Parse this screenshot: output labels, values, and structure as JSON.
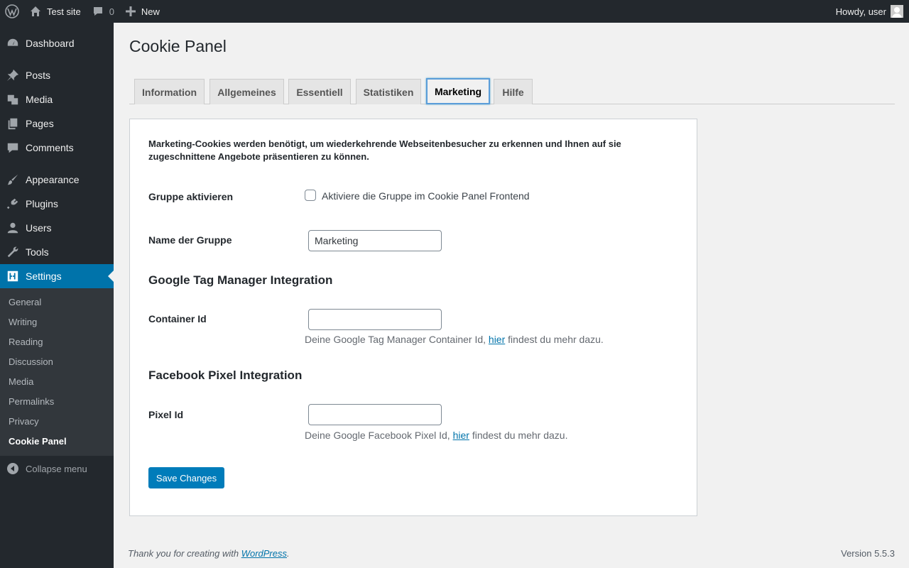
{
  "adminbar": {
    "site_name": "Test site",
    "comments_count": "0",
    "new_label": "New",
    "howdy": "Howdy, user"
  },
  "sidebar": {
    "items": [
      {
        "label": "Dashboard",
        "icon": "dashboard-icon"
      },
      {
        "label": "Posts",
        "icon": "pin-icon"
      },
      {
        "label": "Media",
        "icon": "media-icon"
      },
      {
        "label": "Pages",
        "icon": "pages-icon"
      },
      {
        "label": "Comments",
        "icon": "comment-icon"
      },
      {
        "label": "Appearance",
        "icon": "brush-icon"
      },
      {
        "label": "Plugins",
        "icon": "plug-icon"
      },
      {
        "label": "Users",
        "icon": "user-icon"
      },
      {
        "label": "Tools",
        "icon": "wrench-icon"
      },
      {
        "label": "Settings",
        "icon": "settings-icon"
      }
    ],
    "submenu": [
      "General",
      "Writing",
      "Reading",
      "Discussion",
      "Media",
      "Permalinks",
      "Privacy",
      "Cookie Panel"
    ],
    "collapse_label": "Collapse menu"
  },
  "page": {
    "title": "Cookie Panel",
    "tabs": [
      "Information",
      "Allgemeines",
      "Essentiell",
      "Statistiken",
      "Marketing",
      "Hilfe"
    ],
    "active_tab": "Marketing",
    "description": "Marketing-Cookies werden benötigt, um wiederkehrende Webseitenbesucher zu erkennen und Ihnen auf sie zugeschnittene Angebote präsentieren zu können.",
    "group_activate_label": "Gruppe aktivieren",
    "group_activate_checkbox_label": "Aktiviere die Gruppe im Cookie Panel Frontend",
    "group_name_label": "Name der Gruppe",
    "group_name_value": "Marketing",
    "gtm_section_title": "Google Tag Manager Integration",
    "container_id_label": "Container Id",
    "container_id_value": "",
    "container_help_before": "Deine Google Tag Manager Container Id, ",
    "container_help_link": "hier",
    "container_help_after": " findest du mehr dazu.",
    "fb_section_title": "Facebook Pixel Integration",
    "pixel_id_label": "Pixel Id",
    "pixel_id_value": "",
    "pixel_help_before": "Deine Google Facebook Pixel Id, ",
    "pixel_help_link": "hier",
    "pixel_help_after": " findest du mehr dazu.",
    "save_label": "Save Changes"
  },
  "footer": {
    "thanks_before": "Thank you for creating with ",
    "thanks_link": "WordPress",
    "thanks_after": ".",
    "version": "Version 5.5.3"
  },
  "colors": {
    "adminbar_bg": "#23282d",
    "accent": "#0073aa",
    "button": "#007cba"
  }
}
